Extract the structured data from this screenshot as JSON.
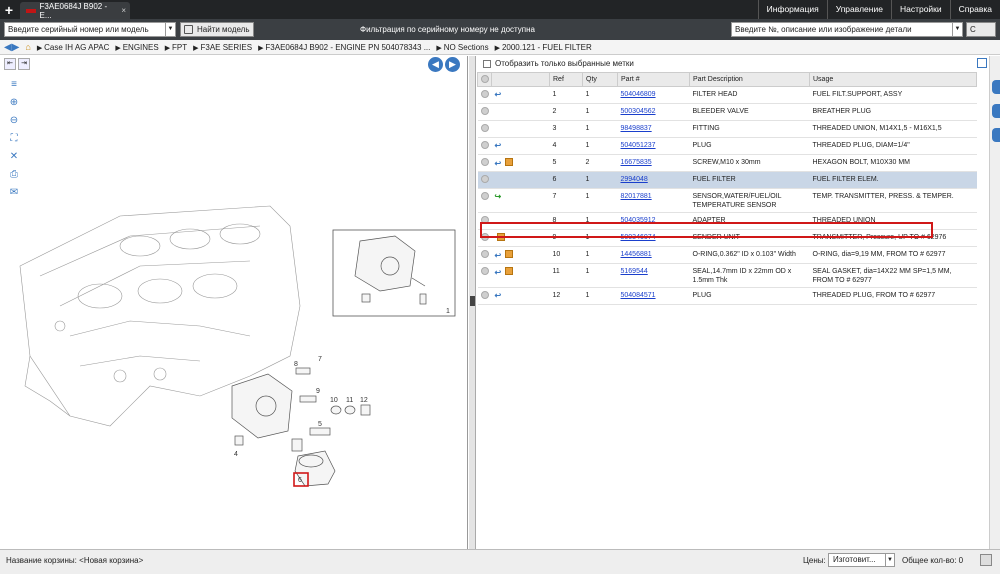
{
  "topbar": {
    "tab_title": "F3AE0684J B902 - E...",
    "menu": [
      "Информация",
      "Управление",
      "Настройки",
      "Справка"
    ]
  },
  "search": {
    "serial_select": "Введите серийный номер или модель",
    "find_model_button": "Найти модель",
    "message": "Фильтрация по серийному номеру не доступна",
    "right_select": "Введите №, описание или изображение детали"
  },
  "breadcrumbs": [
    "Case IH AG APAC",
    "ENGINES",
    "FPT",
    "F3AE SERIES",
    "F3AE0684J B902 - ENGINE PN 504078343 ...",
    "NO Sections",
    "2000.121 - FUEL FILTER"
  ],
  "filter": {
    "label": "Отобразить только выбранные метки"
  },
  "table": {
    "headers": [
      "Ref",
      "Qty",
      "Part #",
      "Part Description",
      "Usage"
    ],
    "rows": [
      {
        "ref": "1",
        "qty": "1",
        "part": "504046809",
        "desc": "FILTER HEAD",
        "usage": "FUEL FILT.SUPPORT,  ASSY",
        "icons": [
          "info"
        ]
      },
      {
        "ref": "2",
        "qty": "1",
        "part": "500304562",
        "desc": "BLEEDER VALVE",
        "usage": "BREATHER PLUG",
        "icons": []
      },
      {
        "ref": "3",
        "qty": "1",
        "part": "98498837",
        "desc": "FITTING",
        "usage": "THREADED UNION, M14X1,5 - M16X1,5",
        "icons": []
      },
      {
        "ref": "4",
        "qty": "1",
        "part": "504051237",
        "desc": "PLUG",
        "usage": "THREADED PLUG, DIAM=1/4\"",
        "icons": [
          "info"
        ]
      },
      {
        "ref": "5",
        "qty": "2",
        "part": "16675835",
        "desc": "SCREW,M10 x 30mm",
        "usage": "HEXAGON BOLT, M10X30 MM",
        "icons": [
          "info",
          "box"
        ]
      },
      {
        "ref": "6",
        "qty": "1",
        "part": "2994048",
        "desc": "FUEL FILTER",
        "usage": "FUEL FILTER ELEM.",
        "icons": []
      },
      {
        "ref": "7",
        "qty": "1",
        "part": "82017881",
        "desc": "SENSOR,WATER/FUEL/OIL TEMPERATURE SENSOR",
        "usage": "TEMP. TRANSMITTER, PRESS. & TEMPER.",
        "icons": [
          "replace"
        ]
      },
      {
        "ref": "8",
        "qty": "1",
        "part": "504035912",
        "desc": "ADAPTER",
        "usage": "THREADED UNION",
        "icons": []
      },
      {
        "ref": "9",
        "qty": "1",
        "part": "500346074",
        "desc": "SENDER UNIT",
        "usage": "TRANSMITTER, Pressure, UP TO # 62976",
        "icons": [
          "box"
        ]
      },
      {
        "ref": "10",
        "qty": "1",
        "part": "14456881",
        "desc": "O-RING,0.362\" ID x 0.103\" Width",
        "usage": "O-RING, dia=9,19 MM, FROM TO # 62977",
        "icons": [
          "info",
          "box"
        ]
      },
      {
        "ref": "11",
        "qty": "1",
        "part": "5169544",
        "desc": "SEAL,14.7mm ID x 22mm OD x 1.5mm Thk",
        "usage": "SEAL GASKET, dia=14X22 MM SP=1,5 MM, FROM TO # 62977",
        "icons": [
          "info",
          "box"
        ]
      },
      {
        "ref": "12",
        "qty": "1",
        "part": "504084571",
        "desc": "PLUG",
        "usage": "THREADED PLUG, FROM TO # 62977",
        "icons": [
          "info"
        ]
      }
    ]
  },
  "diagram": {
    "labels": [
      "1",
      "8",
      "7",
      "9",
      "10",
      "11",
      "12",
      "5",
      "4",
      "6"
    ]
  },
  "bottom": {
    "basket_label": "Название корзины:",
    "basket_name": "<Новая корзина>",
    "prices_label": "Цены:",
    "prices_select": "Изготовит...",
    "total": "Общее кол-во: 0"
  }
}
